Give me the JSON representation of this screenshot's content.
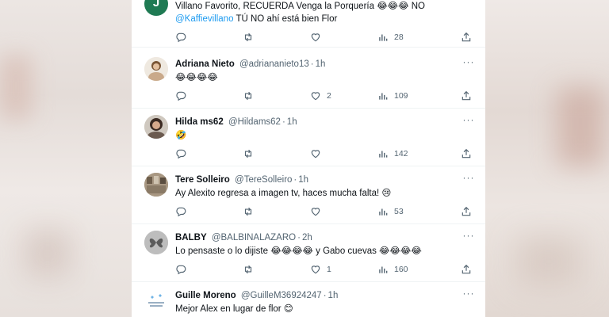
{
  "tweets": [
    {
      "id": "t0",
      "avatar_letter": "J",
      "avatar_color": "#1f7a53",
      "lines": [
        "Villano Favorito, RECUERDA Venga la Porquería 😂😂😂 NO"
      ],
      "mention": "@Kaffievillano",
      "line2_rest": " TÚ NO ahí está bien Flor",
      "reply_count": "",
      "retweet_count": "",
      "like_count": "",
      "view_count": "28"
    },
    {
      "id": "t1",
      "name": "Adriana Nieto",
      "handle": "@adriananieto13",
      "time": "1h",
      "text": "😂😂😂😂",
      "reply_count": "",
      "retweet_count": "",
      "like_count": "2",
      "view_count": "109"
    },
    {
      "id": "t2",
      "name": "Hilda ms62",
      "handle": "@Hildams62",
      "time": "1h",
      "text": "🤣",
      "reply_count": "",
      "retweet_count": "",
      "like_count": "",
      "view_count": "142"
    },
    {
      "id": "t3",
      "name": "Tere Solleiro",
      "handle": "@TereSolleiro",
      "time": "1h",
      "text": "Ay Alexito regresa a imagen tv, haces mucha falta! 😢",
      "reply_count": "",
      "retweet_count": "",
      "like_count": "",
      "view_count": "53"
    },
    {
      "id": "t4",
      "name": "BALBY",
      "handle": "@BALBINALAZARO",
      "time": "2h",
      "text": "Lo pensaste o lo dijiste 😂😂😂😂 y Gabo cuevas 😂😂😂😂",
      "reply_count": "",
      "retweet_count": "",
      "like_count": "1",
      "view_count": "160"
    },
    {
      "id": "t5",
      "name": "Guille Moreno",
      "handle": "@GuilleM36924247",
      "time": "1h",
      "text": "Mejor Alex en lugar de flor 😊"
    }
  ],
  "icons": {
    "reply": "reply-icon",
    "retweet": "retweet-icon",
    "like": "heart-icon",
    "views": "views-icon",
    "share": "share-icon",
    "more": "more-icon"
  },
  "colors": {
    "link": "#1d9bf0",
    "text": "#0f1419",
    "secondary": "#536471"
  }
}
